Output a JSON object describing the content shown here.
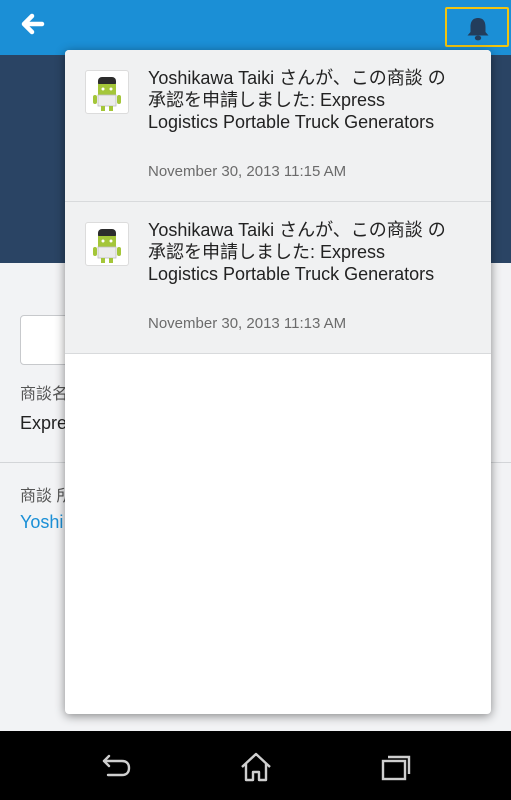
{
  "header": {
    "back_icon": "arrow-left-icon",
    "notifications_icon": "bell-icon",
    "accent": "#1b8fd6",
    "hero_color": "#2a4464"
  },
  "background": {
    "field1_label": "商談名",
    "field1_value": "Expre",
    "field2_label": "商談 所",
    "field2_link": "Yoshi"
  },
  "notifications": [
    {
      "text": "Yoshikawa Taiki さんが、この商談 の承認を申請しました: Express Logistics Portable Truck Generators",
      "time": "November 30, 2013 11:15 AM",
      "avatar_icon": "android-avatar-icon"
    },
    {
      "text": "Yoshikawa Taiki さんが、この商談 の承認を申請しました: Express Logistics Portable Truck Generators",
      "time": "November 30, 2013 11:13 AM",
      "avatar_icon": "android-avatar-icon"
    }
  ],
  "system_nav": {
    "back_icon": "back-icon",
    "home_icon": "home-icon",
    "recent_icon": "recent-apps-icon"
  }
}
